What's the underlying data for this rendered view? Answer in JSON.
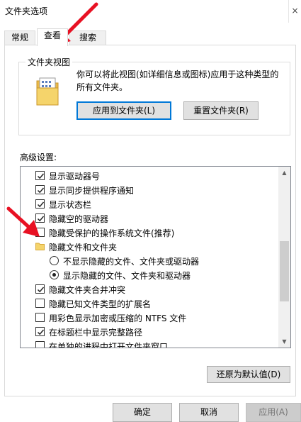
{
  "window": {
    "title": "文件夹选项",
    "close": "×"
  },
  "tabs": [
    {
      "label": "常规",
      "active": false
    },
    {
      "label": "查看",
      "active": true
    },
    {
      "label": "搜索",
      "active": false
    }
  ],
  "folder_views": {
    "legend": "文件夹视图",
    "description": "你可以将此视图(如详细信息或图标)应用于这种类型的所有文件夹。",
    "apply_label": "应用到文件夹(L)",
    "reset_label": "重置文件夹(R)"
  },
  "advanced": {
    "label": "高级设置:",
    "items": [
      {
        "type": "checkbox",
        "checked": true,
        "label": "显示驱动器号"
      },
      {
        "type": "checkbox",
        "checked": true,
        "label": "显示同步提供程序通知"
      },
      {
        "type": "checkbox",
        "checked": true,
        "label": "显示状态栏"
      },
      {
        "type": "checkbox",
        "checked": true,
        "label": "隐藏空的驱动器"
      },
      {
        "type": "checkbox",
        "checked": false,
        "label": "隐藏受保护的操作系统文件(推荐)"
      },
      {
        "type": "folder",
        "label": "隐藏文件和文件夹"
      },
      {
        "type": "radio",
        "checked": false,
        "label": "不显示隐藏的文件、文件夹或驱动器"
      },
      {
        "type": "radio",
        "checked": true,
        "label": "显示隐藏的文件、文件夹和驱动器"
      },
      {
        "type": "checkbox",
        "checked": true,
        "label": "隐藏文件夹合并冲突"
      },
      {
        "type": "checkbox",
        "checked": false,
        "label": "隐藏已知文件类型的扩展名"
      },
      {
        "type": "checkbox",
        "checked": false,
        "label": "用彩色显示加密或压缩的 NTFS 文件"
      },
      {
        "type": "checkbox",
        "checked": true,
        "label": "在标题栏中显示完整路径"
      },
      {
        "type": "checkbox",
        "checked": false,
        "label": "在单独的进程中打开文件夹窗口"
      }
    ],
    "restore_label": "还原为默认值(D)"
  },
  "footer": {
    "ok_label": "确定",
    "cancel_label": "取消",
    "apply_label": "应用(A)"
  },
  "colors": {
    "accent": "#0078d7",
    "annotation": "#e81123",
    "folder": "#f5d46b"
  }
}
